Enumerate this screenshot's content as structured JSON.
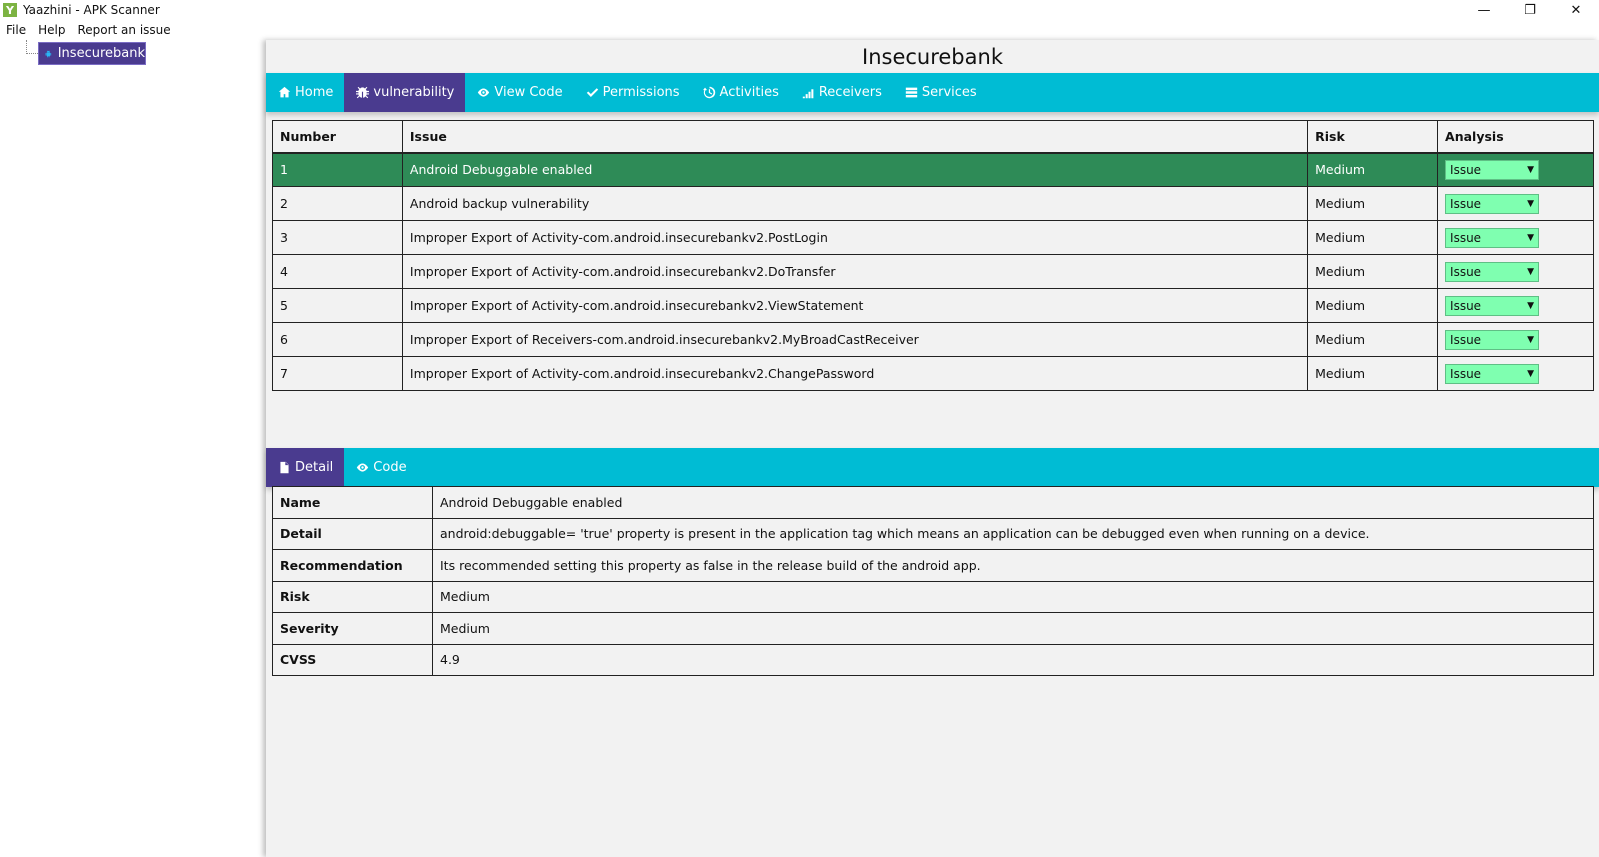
{
  "window": {
    "title": "Yaazhini - APK Scanner",
    "logo_letter": "Y",
    "controls": [
      "—",
      "❐",
      "✕"
    ]
  },
  "menu": [
    "File",
    "Help",
    "Report an issue"
  ],
  "tree": {
    "node_label": "Insecurebank"
  },
  "page_title": "Insecurebank",
  "top_tabs": [
    {
      "label": "Home",
      "icon": "home-icon"
    },
    {
      "label": "vulnerability",
      "icon": "bug-icon"
    },
    {
      "label": "View Code",
      "icon": "eye-icon"
    },
    {
      "label": "Permissions",
      "icon": "check-icon"
    },
    {
      "label": "Activities",
      "icon": "history-icon"
    },
    {
      "label": "Receivers",
      "icon": "signal-icon"
    },
    {
      "label": "Services",
      "icon": "list-icon"
    }
  ],
  "vuln_table": {
    "headers": [
      "Number",
      "Issue",
      "Risk",
      "Analysis"
    ],
    "rows": [
      {
        "number": "1",
        "issue": "Android Debuggable enabled",
        "risk": "Medium",
        "analysis": "Issue"
      },
      {
        "number": "2",
        "issue": "Android backup vulnerability",
        "risk": "Medium",
        "analysis": "Issue"
      },
      {
        "number": "3",
        "issue": "Improper Export of Activity-com.android.insecurebankv2.PostLogin",
        "risk": "Medium",
        "analysis": "Issue"
      },
      {
        "number": "4",
        "issue": "Improper Export of Activity-com.android.insecurebankv2.DoTransfer",
        "risk": "Medium",
        "analysis": "Issue"
      },
      {
        "number": "5",
        "issue": "Improper Export of Activity-com.android.insecurebankv2.ViewStatement",
        "risk": "Medium",
        "analysis": "Issue"
      },
      {
        "number": "6",
        "issue": "Improper Export of Receivers-com.android.insecurebankv2.MyBroadCastReceiver",
        "risk": "Medium",
        "analysis": "Issue"
      },
      {
        "number": "7",
        "issue": "Improper Export of Activity-com.android.insecurebankv2.ChangePassword",
        "risk": "Medium",
        "analysis": "Issue"
      }
    ]
  },
  "bottom_tabs": [
    {
      "label": "Detail",
      "icon": "file-icon"
    },
    {
      "label": "Code",
      "icon": "eye-icon"
    }
  ],
  "detail": [
    {
      "label": "Name",
      "value": "Android Debuggable enabled"
    },
    {
      "label": "Detail",
      "value": "android:debuggable= 'true' property is present in the application tag which means an application can be debugged even when running on a device."
    },
    {
      "label": "Recommendation",
      "value": "Its recommended setting this property as false in the release build of the android app."
    },
    {
      "label": "Risk",
      "value": "Medium"
    },
    {
      "label": "Severity",
      "value": "Medium"
    },
    {
      "label": "CVSS",
      "value": "4.9"
    }
  ],
  "colors": {
    "accent": "#00bcd4",
    "active_tab": "#4a3b8f",
    "selected_row": "#2e8b57",
    "select_bg": "#7fffb0"
  }
}
